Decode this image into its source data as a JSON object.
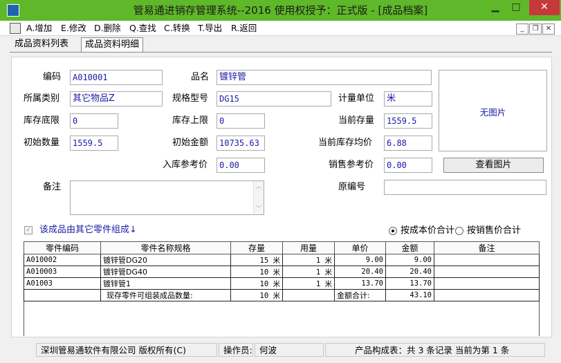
{
  "window": {
    "title": "管易通进销存管理系统--2016  使用权授予：正式版 - [成品档案]",
    "minimize": "▁",
    "restore": "□",
    "close": "✕"
  },
  "menu": {
    "items": [
      "A.增加",
      "E.修改",
      "D.删除",
      "Q.查找",
      "C.转换",
      "T.导出",
      "R.返回"
    ],
    "mdi_min": "_",
    "mdi_restore": "❐",
    "mdi_close": "✕"
  },
  "tabs": [
    "成品资料列表",
    "成品资料明细"
  ],
  "form": {
    "code_label": "编码",
    "code_value": "A010001",
    "name_label": "品名",
    "name_value": "镀锌管",
    "category_label": "所属类别",
    "category_value": "其它物品Z",
    "spec_label": "规格型号",
    "spec_value": "DG15",
    "unit_label": "计量单位",
    "unit_value": "米",
    "min_stock_label": "库存底限",
    "min_stock_value": "0",
    "max_stock_label": "库存上限",
    "max_stock_value": "0",
    "current_stock_label": "当前存量",
    "current_stock_value": "1559.5",
    "initial_qty_label": "初始数量",
    "initial_qty_value": "1559.5",
    "initial_amount_label": "初始金额",
    "initial_amount_value": "10735.63",
    "avg_price_label": "当前库存均价",
    "avg_price_value": "6.88",
    "in_ref_price_label": "入库参考价",
    "in_ref_price_value": "0.00",
    "sale_ref_price_label": "销售参考价",
    "sale_ref_price_value": "0.00",
    "remark_label": "备注",
    "old_code_label": "原编号",
    "old_code_value": "",
    "no_image_text": "无图片",
    "view_image_button": "查看图片"
  },
  "assembly": {
    "checkbox_label": "该成品由其它零件组成↓",
    "radio_cost": "按成本价合计",
    "radio_sale": "按销售价合计"
  },
  "table": {
    "headers": [
      "零件编码",
      "零件名称规格",
      "存量",
      "用量",
      "单价",
      "金额",
      "备注"
    ],
    "rows": [
      {
        "code": "A010002",
        "name": "镀锌管DG20",
        "stock": "15 米",
        "usage": "1 米",
        "price": "9.00",
        "amount": "9.00",
        "note": ""
      },
      {
        "code": "A010003",
        "name": "镀锌管DG40",
        "stock": "10 米",
        "usage": "1 米",
        "price": "20.40",
        "amount": "20.40",
        "note": ""
      },
      {
        "code": "A01003",
        "name": "镀锌管1",
        "stock": "10 米",
        "usage": "1 米",
        "price": "13.70",
        "amount": "13.70",
        "note": ""
      }
    ],
    "summary": {
      "label": "现存零件可组装成品数量:",
      "qty": "10 米",
      "total_label": "金额合计:",
      "total": "43.10"
    }
  },
  "status": {
    "company": "深圳管易通软件有限公司 版权所有(C)",
    "operator_label": "操作员:",
    "operator": "何波",
    "records": "产品构成表：共 3 条记录 当前为第 1 条"
  },
  "colors": {
    "titlebar": "#5fb829",
    "close_button": "#c7383a",
    "field_text": "#1a1aa6"
  }
}
